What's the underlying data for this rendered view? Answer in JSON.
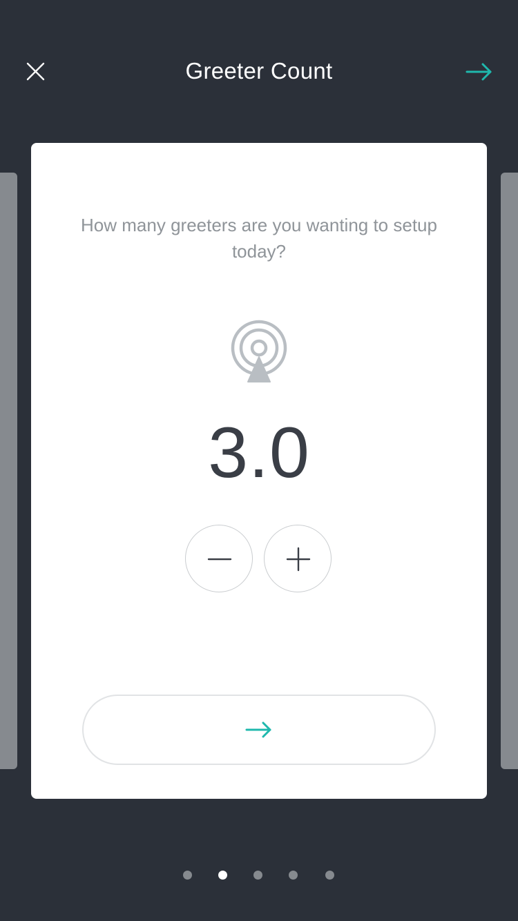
{
  "header": {
    "title": "Greeter Count",
    "close_icon": "close-icon",
    "next_icon": "arrow-right-icon"
  },
  "card": {
    "question": "How many greeters are you wanting to setup today?",
    "icon": "beacon-icon",
    "count": "3.0",
    "decrement_icon": "minus-icon",
    "increment_icon": "plus-icon",
    "continue_icon": "arrow-right-icon"
  },
  "pager": {
    "total": 5,
    "active_index": 1
  },
  "colors": {
    "background": "#2b3039",
    "accent": "#1fb8ad",
    "card": "#ffffff",
    "side_card": "#868a8f",
    "dot_inactive": "#868a8f",
    "dot_active": "#ffffff"
  }
}
